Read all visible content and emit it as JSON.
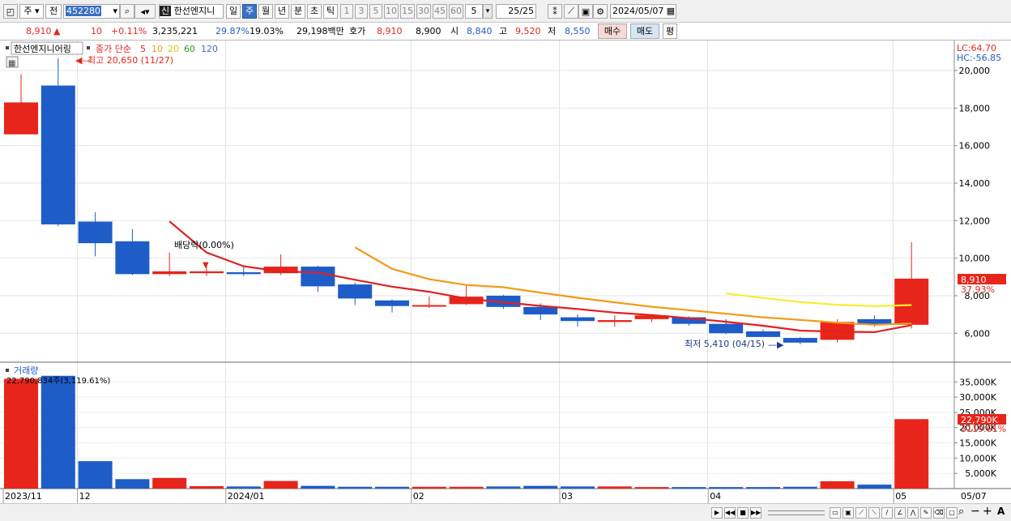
{
  "toolbar": {
    "period": "주",
    "prev": "전",
    "code": "452280",
    "stock_badge": "신",
    "stock_name": "한선엔지니",
    "tabs": [
      "일",
      "주",
      "월",
      "년",
      "분",
      "초",
      "틱"
    ],
    "active_tab": "주",
    "intervals": [
      "1",
      "3",
      "5",
      "10",
      "15",
      "30",
      "45",
      "60"
    ],
    "unit_value": "5",
    "page": "25/25",
    "date": "2024/05/07"
  },
  "quote": {
    "price": "8,910",
    "arrow": "▲",
    "change": "10",
    "change_pct": "+0.11%",
    "volume": "3,235,221",
    "vol_ratio": "29.87%",
    "turnover": "19.03%",
    "amount": "29,198백만",
    "ask_label": "호가",
    "ask": "8,910",
    "bid": "8,900",
    "open_label": "시",
    "open": "8,840",
    "high_label": "고",
    "high": "9,520",
    "low_label": "저",
    "low": "8,550",
    "buy_label": "매수",
    "sell_label": "매도",
    "avg_label": "평"
  },
  "legend": {
    "name": "한선엔지니어링",
    "ma_label": "종가 단순",
    "ma_periods": [
      "5",
      "10",
      "20",
      "60",
      "120"
    ],
    "ma_colors": [
      "#e02020",
      "#f29a16",
      "#e8d800",
      "#2a9a2a",
      "#3a6fc4"
    ]
  },
  "annotations": {
    "high": "최고 20,650 (11/27)",
    "low": "최저 5,410 (04/15)",
    "dividend": "배당락(0.00%)"
  },
  "right_panel": {
    "lc": "LC:64.70",
    "hc": "HC:-56.85",
    "price_tag": "8,910",
    "pct_tag": "37.93%",
    "vol_tag": "22,790K",
    "vol_pct": "3119.61%"
  },
  "volume_panel": {
    "title": "거래량",
    "info": "22,790,834주(3,119.61%)"
  },
  "x_axis": {
    "labels": [
      "2023/11",
      "12",
      "2024/01",
      "02",
      "03",
      "04",
      "05"
    ],
    "end_label": "05/07"
  },
  "colors": {
    "up": "#e8251a",
    "down": "#1e5cc8",
    "ma5": "#e02020",
    "ma10": "#f29a16",
    "ma20": "#f5ee30"
  },
  "chart_data": [
    {
      "type": "candlestick",
      "title": "한선엔지니어링",
      "x": [
        "11/13",
        "11/20",
        "11/27",
        "12/04",
        "12/11",
        "12/18",
        "12/25",
        "01/01",
        "01/08",
        "01/15",
        "01/22",
        "01/29",
        "02/05",
        "02/12",
        "02/19",
        "02/26",
        "03/04",
        "03/11",
        "03/18",
        "03/25",
        "04/01",
        "04/08",
        "04/15",
        "04/22",
        "04/29",
        "05/06"
      ],
      "ohlc": [
        [
          16600,
          19800,
          16600,
          18300
        ],
        [
          19200,
          20650,
          11700,
          11800
        ],
        [
          11950,
          12450,
          10100,
          10800
        ],
        [
          10900,
          11550,
          9100,
          9150
        ],
        [
          9150,
          10300,
          9050,
          9300
        ],
        [
          9200,
          9650,
          9050,
          9300
        ],
        [
          9250,
          9550,
          9050,
          9150
        ],
        [
          9200,
          10200,
          9100,
          9550
        ],
        [
          9550,
          9600,
          8200,
          8500
        ],
        [
          8600,
          8700,
          7500,
          7850
        ],
        [
          7750,
          7800,
          7100,
          7450
        ],
        [
          7450,
          7950,
          7350,
          7500
        ],
        [
          7550,
          8550,
          7500,
          7950
        ],
        [
          8000,
          8050,
          7300,
          7400
        ],
        [
          7400,
          7600,
          6700,
          7000
        ],
        [
          6850,
          7000,
          6350,
          6650
        ],
        [
          6600,
          6950,
          6350,
          6700
        ],
        [
          6750,
          6950,
          6600,
          6950
        ],
        [
          6850,
          6900,
          6400,
          6500
        ],
        [
          6500,
          6750,
          5950,
          6000
        ],
        [
          6100,
          6200,
          5850,
          5800
        ],
        [
          5750,
          5800,
          5410,
          5500
        ],
        [
          5650,
          6750,
          5500,
          6600
        ],
        [
          6750,
          6950,
          6350,
          6450
        ],
        [
          6450,
          10850,
          6250,
          8910
        ]
      ],
      "ma": [
        {
          "name": "5",
          "values": [
            null,
            null,
            null,
            null,
            11960,
            10300,
            9570,
            9290,
            9240,
            8850,
            8480,
            8210,
            7850,
            7650,
            7460,
            7290,
            7100,
            6970,
            6800,
            6610,
            6400,
            6140,
            6080,
            6060,
            6430
          ]
        },
        {
          "name": "10",
          "values": [
            null,
            null,
            null,
            null,
            null,
            null,
            null,
            null,
            null,
            10580,
            9430,
            8880,
            8570,
            8450,
            8160,
            7890,
            7650,
            7410,
            7230,
            7040,
            6850,
            6710,
            6560,
            6450,
            6520
          ]
        },
        {
          "name": "20",
          "values": [
            null,
            null,
            null,
            null,
            null,
            null,
            null,
            null,
            null,
            null,
            null,
            null,
            null,
            null,
            null,
            null,
            null,
            null,
            null,
            8120,
            7880,
            7660,
            7520,
            7440,
            7500
          ]
        }
      ],
      "volume_k": [
        36000,
        37000,
        9000,
        3100,
        3500,
        800,
        700,
        2500,
        900,
        600,
        600,
        600,
        600,
        700,
        900,
        700,
        700,
        500,
        500,
        500,
        500,
        600,
        2400,
        1300,
        22790
      ],
      "ylim": [
        4500,
        21600
      ],
      "yticks": [
        "6,000",
        "8,000",
        "10,000",
        "12,000",
        "14,000",
        "16,000",
        "18,000",
        "20,000"
      ],
      "vol_yticks": [
        "5,000K",
        "10,000K",
        "15,000K",
        "20,000K",
        "25,000K",
        "30,000K",
        "35,000K"
      ],
      "vol_ylim": [
        0,
        38000
      ]
    }
  ]
}
